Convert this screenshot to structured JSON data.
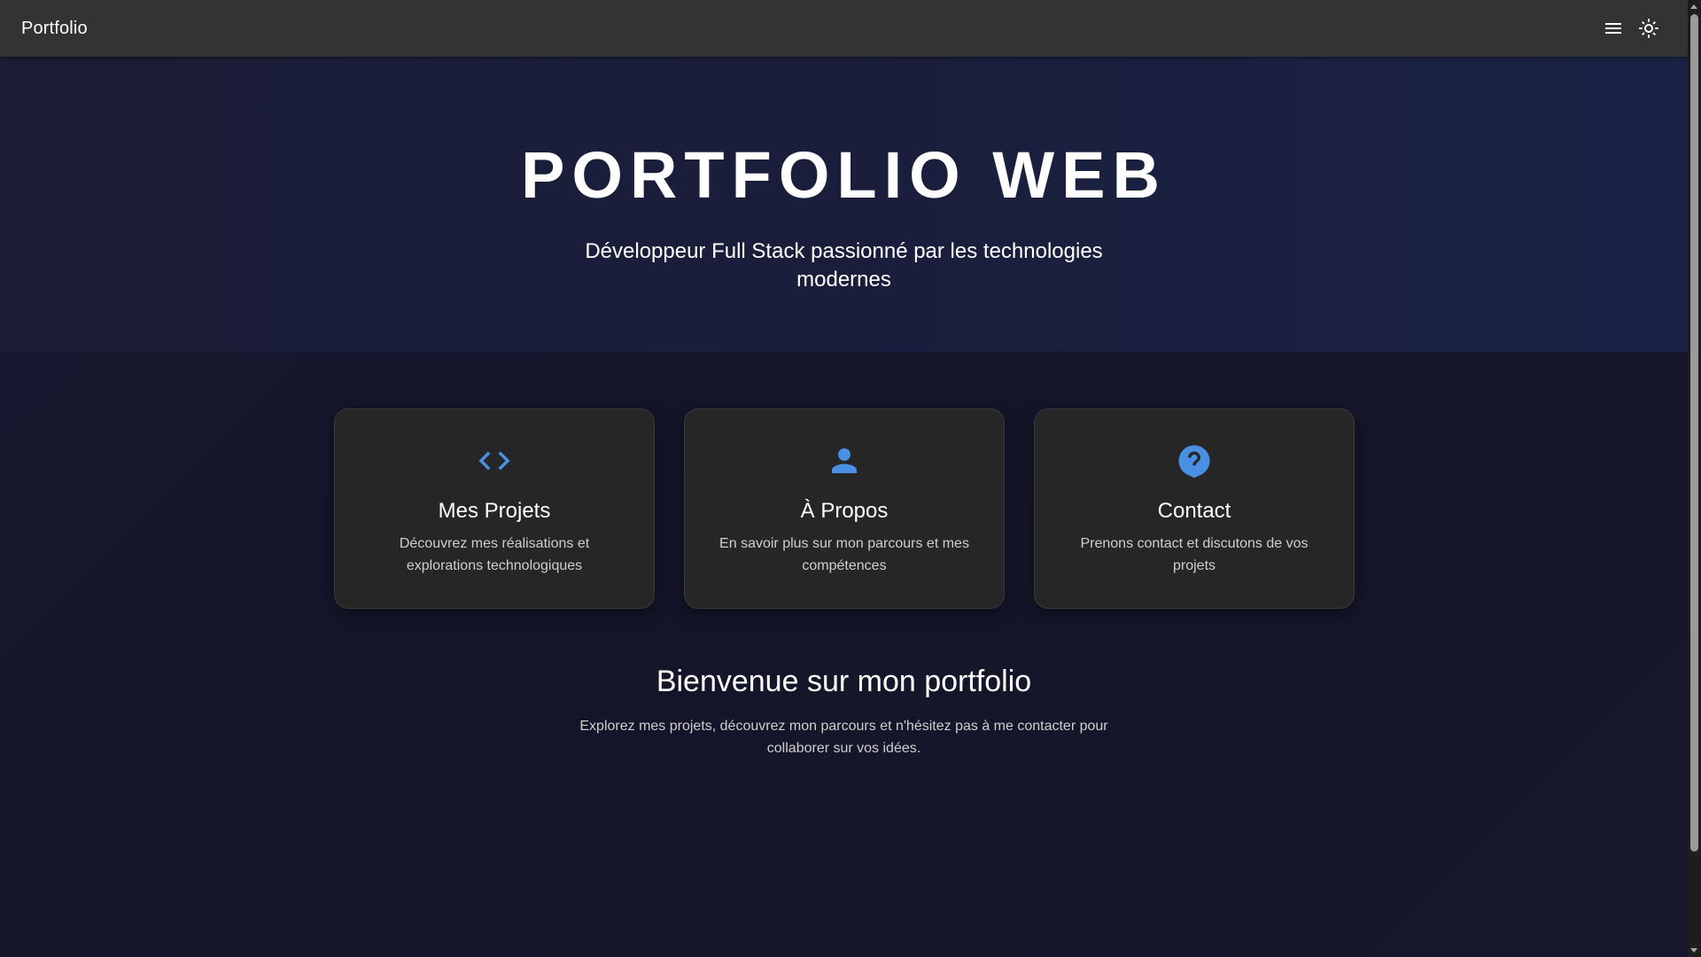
{
  "appbar": {
    "brand": "Portfolio",
    "menu_icon": "menu-icon",
    "theme_icon": "sun-icon"
  },
  "hero": {
    "title": "PORTFOLIO WEB",
    "subtitle": "Développeur Full Stack passionné par les technologies modernes"
  },
  "cards": [
    {
      "icon": "code-icon",
      "title": "Mes Projets",
      "description": "Découvrez mes réalisations et explorations technologiques"
    },
    {
      "icon": "person-icon",
      "title": "À Propos",
      "description": "En savoir plus sur mon parcours et mes compétences"
    },
    {
      "icon": "help-icon",
      "title": "Contact",
      "description": "Prenons contact et discutons de vos projets"
    }
  ],
  "welcome": {
    "title": "Bienvenue sur mon portfolio",
    "text": "Explorez mes projets, découvrez mon parcours et n'hésitez pas à me contacter pour collaborer sur vos idées."
  },
  "colors": {
    "accent": "#4a90e2",
    "appbar": "#333333",
    "card": "#262626",
    "background": "#14152a"
  }
}
